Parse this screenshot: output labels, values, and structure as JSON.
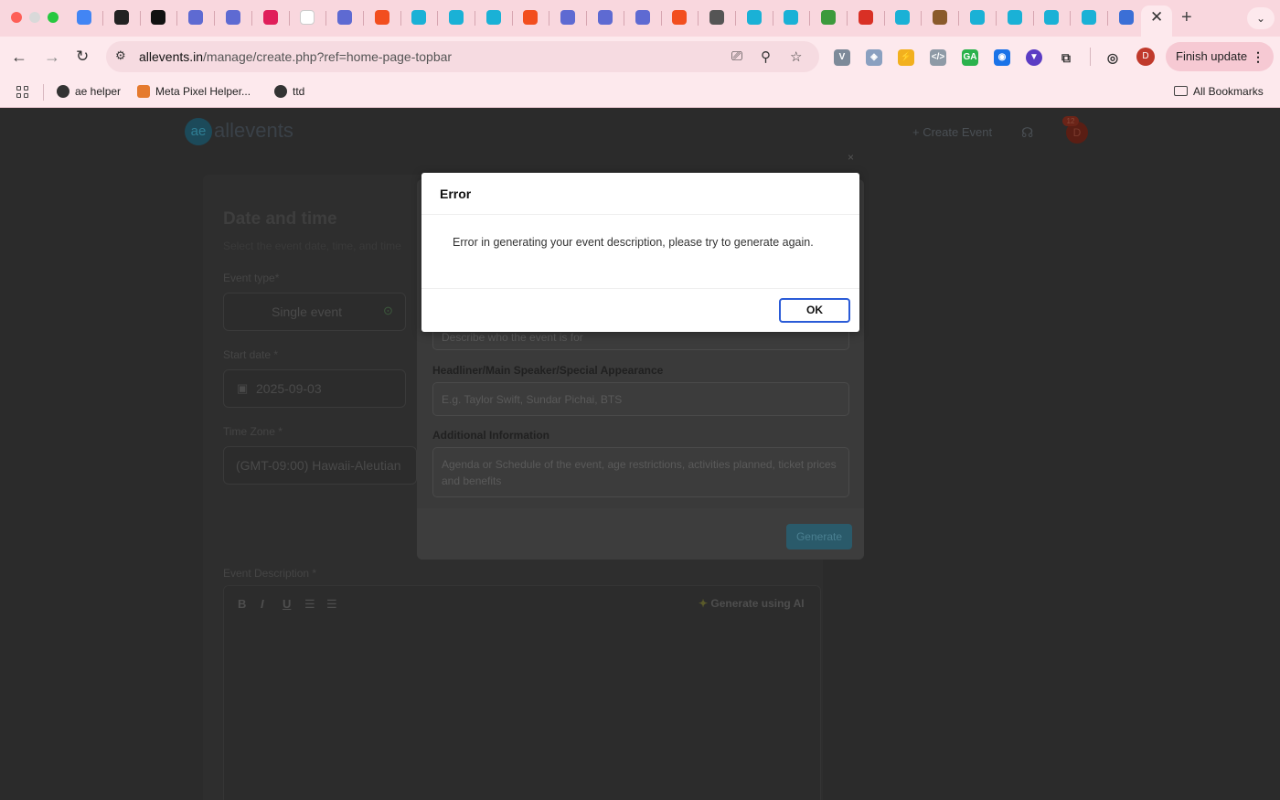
{
  "browser": {
    "tabs": [
      {
        "icon": "google-ads-icon",
        "color": "#4285f4"
      },
      {
        "icon": "chatgpt-icon",
        "color": "#222222"
      },
      {
        "icon": "x-app-icon",
        "color": "#111111"
      },
      {
        "icon": "linear-icon",
        "color": "#5e6ad2"
      },
      {
        "icon": "linear-icon",
        "color": "#5e6ad2"
      },
      {
        "icon": "slack-icon",
        "color": "#e01e5a"
      },
      {
        "icon": "ae-icon",
        "color": "#ffffff"
      },
      {
        "icon": "linear-icon",
        "color": "#5e6ad2"
      },
      {
        "icon": "figma-icon",
        "color": "#f24e1e"
      },
      {
        "icon": "allevents-icon",
        "color": "#1ab1d6"
      },
      {
        "icon": "allevents-icon",
        "color": "#1ab1d6"
      },
      {
        "icon": "allevents-icon",
        "color": "#1ab1d6"
      },
      {
        "icon": "figma-icon",
        "color": "#f24e1e"
      },
      {
        "icon": "linear-icon",
        "color": "#5e6ad2"
      },
      {
        "icon": "linear-icon",
        "color": "#5e6ad2"
      },
      {
        "icon": "linear-icon",
        "color": "#5e6ad2"
      },
      {
        "icon": "figma-icon",
        "color": "#f24e1e"
      },
      {
        "icon": "globe-icon",
        "color": "#555555"
      },
      {
        "icon": "allevents-icon",
        "color": "#1ab1d6"
      },
      {
        "icon": "allevents-icon",
        "color": "#1ab1d6"
      },
      {
        "icon": "b64-icon",
        "color": "#3c9a3c"
      },
      {
        "icon": "gmail-icon",
        "color": "#d93025"
      },
      {
        "icon": "allevents-icon",
        "color": "#1ab1d6"
      },
      {
        "icon": "avatar-icon",
        "color": "#8a5a2b"
      },
      {
        "icon": "allevents-icon",
        "color": "#1ab1d6"
      },
      {
        "icon": "allevents-icon",
        "color": "#1ab1d6"
      },
      {
        "icon": "allevents-icon",
        "color": "#1ab1d6"
      },
      {
        "icon": "allevents-icon",
        "color": "#1ab1d6"
      },
      {
        "icon": "building-icon",
        "color": "#3b6fd6"
      }
    ],
    "url_host": "allevents.in",
    "url_path": "/manage/create.php?ref=home-page-topbar",
    "finish_update": "Finish update",
    "profile_initial": "D",
    "bookmarks": {
      "ae_helper": "ae helper",
      "meta_pixel": "Meta Pixel Helper...",
      "ttd": "ttd",
      "all_bookmarks": "All Bookmarks"
    }
  },
  "page": {
    "logo_text": "allevents",
    "logo_mark": "ae",
    "create_event": "+ Create Event",
    "avatar_initial": "D",
    "badge_count": "12",
    "section_title": "Date and time",
    "section_sub": "Select the event date, time, and time",
    "event_type_label": "Event type*",
    "event_type_value": "Single event",
    "start_date_label": "Start date *",
    "start_date_value": "2025-09-03",
    "time_zone_label": "Time Zone *",
    "time_zone_value": "(GMT-09:00) Hawaii-Aleutian",
    "event_desc_label": "Event Description *",
    "rte": {
      "bold": "B",
      "italic": "I",
      "underline": "U"
    },
    "generate_ai": "Generate using AI"
  },
  "ai_modal": {
    "audience_placeholder": "Describe who the event is for",
    "headliner_label": "Headliner/Main Speaker/Special Appearance",
    "headliner_placeholder": "E.g. Taylor Swift, Sundar Pichai, BTS",
    "additional_label": "Additional Information",
    "additional_placeholder": "Agenda or Schedule of the event, age restrictions, activities planned, ticket prices and benefits",
    "generate_button": "Generate"
  },
  "error_dialog": {
    "title": "Error",
    "message": "Error in generating your event description, please try to generate again.",
    "ok_label": "OK"
  }
}
